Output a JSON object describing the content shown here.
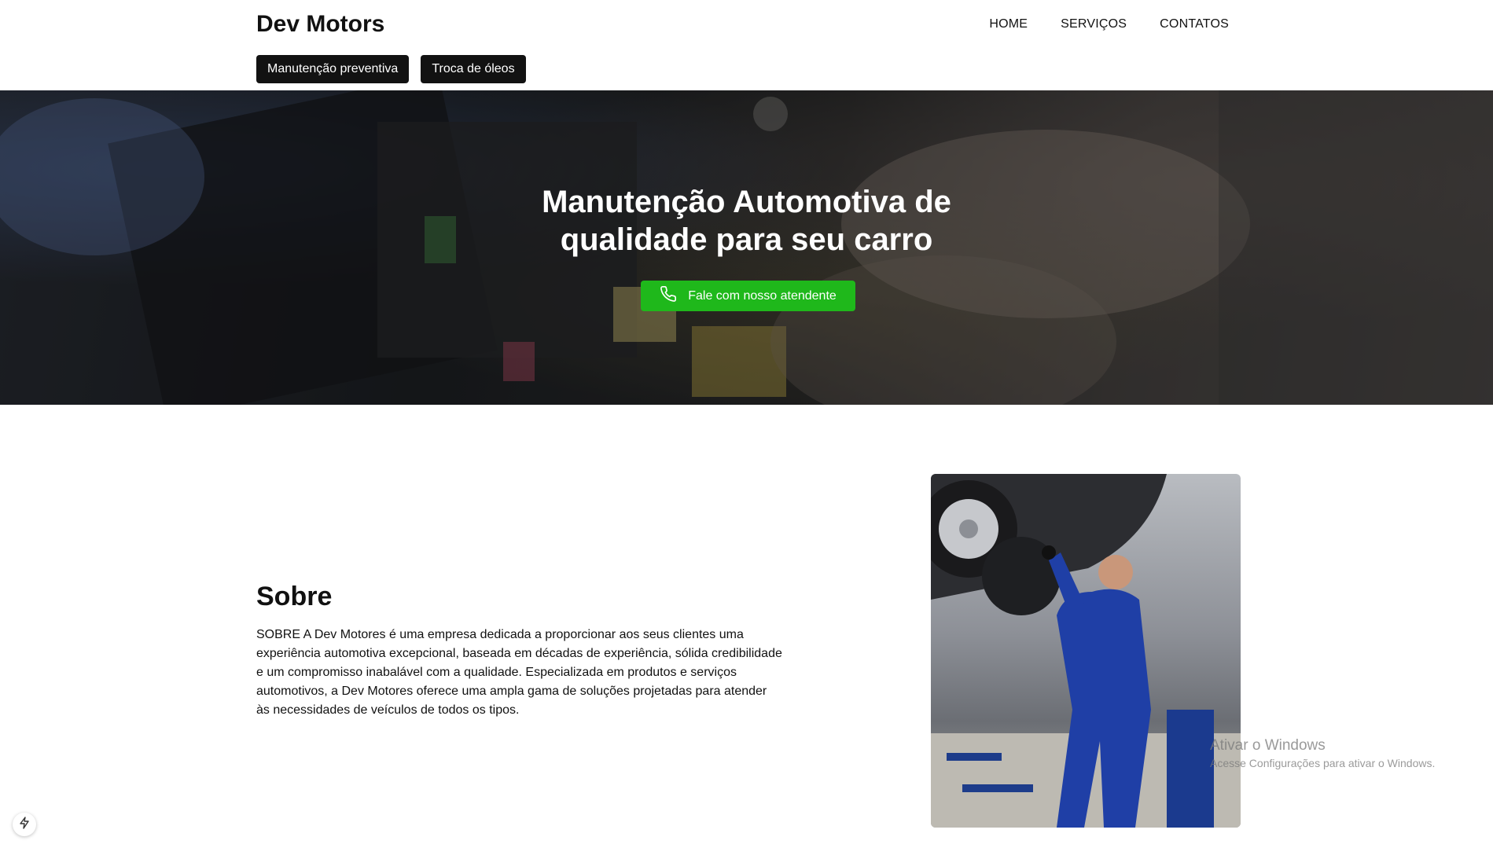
{
  "header": {
    "brand": "Dev Motors",
    "nav": [
      "HOME",
      "SERVIÇOS",
      "CONTATOS"
    ],
    "services": [
      "Manutenção preventiva",
      "Troca de óleos"
    ]
  },
  "hero": {
    "title_line1": "Manutenção Automotiva de",
    "title_line2": "qualidade para seu carro",
    "cta_label": "Fale com nosso atendente",
    "cta_icon": "phone-icon",
    "cta_color": "#1fb81b"
  },
  "about": {
    "title": "Sobre",
    "text": "SOBRE A Dev Motores é uma empresa dedicada a proporcionar aos seus clientes uma experiência automotiva excepcional, baseada em décadas de experiência, sólida credibilidade e um compromisso inabalável com a qualidade. Especializada em produtos e serviços automotivos, a Dev Motores oferece uma ampla gama de soluções projetadas para atender às necessidades de veículos de todos os tipos."
  },
  "watermark": {
    "line1": "Ativar o Windows",
    "line2": "Acesse Configurações para ativar o Windows."
  },
  "colors": {
    "header_bg": "#ffffff",
    "chip_bg": "#121212",
    "text": "#111111"
  }
}
